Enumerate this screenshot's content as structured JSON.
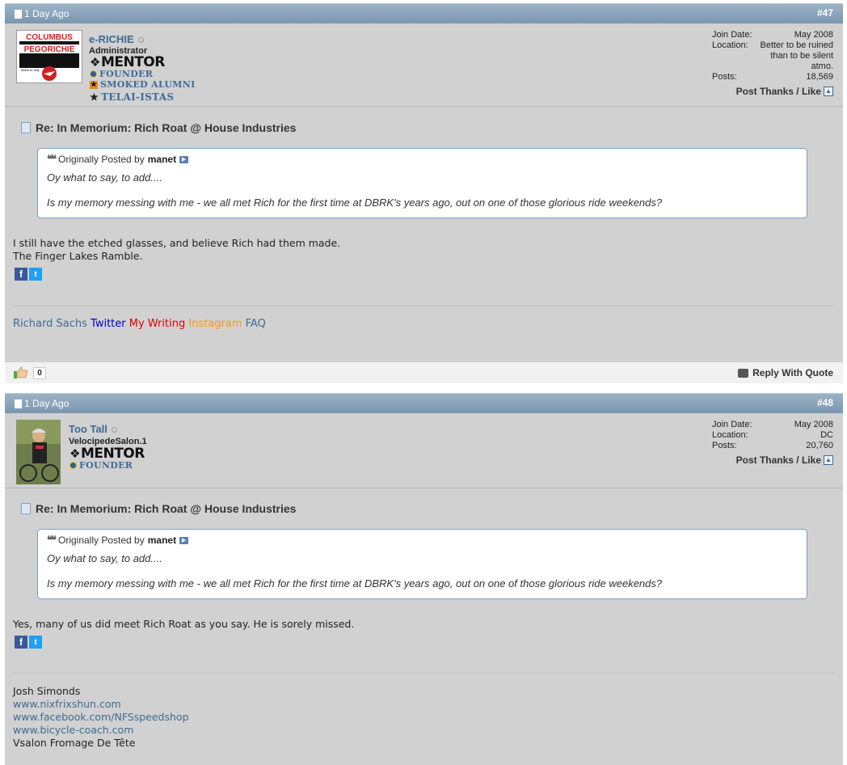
{
  "posts": [
    {
      "date": "1 Day Ago",
      "number": "#47",
      "username": "e-RICHIE",
      "user_title": "Administrator",
      "rank_main": "MENTOR",
      "rank_lines": [
        "FOUNDER",
        "SMOKED ALUMNI",
        "TELAI-ISTAS"
      ],
      "stats": {
        "join_label": "Join Date:",
        "join_value": "May 2008",
        "location_label": "Location:",
        "location_value": "Better to be ruined than to be silent atmo.",
        "posts_label": "Posts:",
        "posts_value": "18,569"
      },
      "thanks_label": "Post Thanks / Like",
      "title": "Re: In Memorium: Rich Roat @ House Industries",
      "quote": {
        "prefix": "Originally Posted by",
        "author": "manet",
        "line1": "Oy what to say, to add....",
        "line2": "Is my memory messing with me - we all met Rich for the first time at DBRK's years ago, out on one of those glorious ride weekends?"
      },
      "body": [
        "I still have the etched glasses, and believe Rich had them made.",
        "The Finger Lakes Ramble."
      ],
      "signature_links": [
        {
          "text": "Richard Sachs",
          "color": "#3d6b92"
        },
        {
          "text": "Twitter",
          "color": "#0000cc"
        },
        {
          "text": "My Writing",
          "color": "#e00000"
        },
        {
          "text": "Instagram",
          "color": "#ff9900"
        },
        {
          "text": "FAQ",
          "color": "#3d6b92"
        }
      ],
      "like_count": "0",
      "reply_label": "Reply With Quote",
      "avatar_text": {
        "top": "COLUMBUS",
        "mid": "PEGORICHIE",
        "small": "Made in Italy"
      }
    },
    {
      "date": "1 Day Ago",
      "number": "#48",
      "username": "Too Tall",
      "user_title": "VelocipedeSalon.1",
      "rank_main": "MENTOR",
      "rank_lines": [
        "FOUNDER"
      ],
      "stats": {
        "join_label": "Join Date:",
        "join_value": "May 2008",
        "location_label": "Location:",
        "location_value": "DC",
        "posts_label": "Posts:",
        "posts_value": "20,760"
      },
      "thanks_label": "Post Thanks / Like",
      "title": "Re: In Memorium: Rich Roat @ House Industries",
      "quote": {
        "prefix": "Originally Posted by",
        "author": "manet",
        "line1": "Oy what to say, to add....",
        "line2": "Is my memory messing with me - we all met Rich for the first time at DBRK's years ago, out on one of those glorious ride weekends?"
      },
      "body": [
        "Yes, many of us did meet Rich Roat as you say. He is sorely missed."
      ],
      "signature": {
        "name": "Josh Simonds",
        "links": [
          "www.nixfrixshun.com",
          "www.facebook.com/NFSspeedshop",
          "www.bicycle-coach.com"
        ],
        "tagline": "Vsalon Fromage De Tête"
      }
    }
  ],
  "icons": [
    "document-icon",
    "online-status-icon",
    "thanks-up-icon",
    "post-title-icon",
    "quote-marks-icon",
    "goto-post-icon",
    "facebook-icon",
    "twitter-icon",
    "like-thumb-icon",
    "reply-quote-icon"
  ]
}
